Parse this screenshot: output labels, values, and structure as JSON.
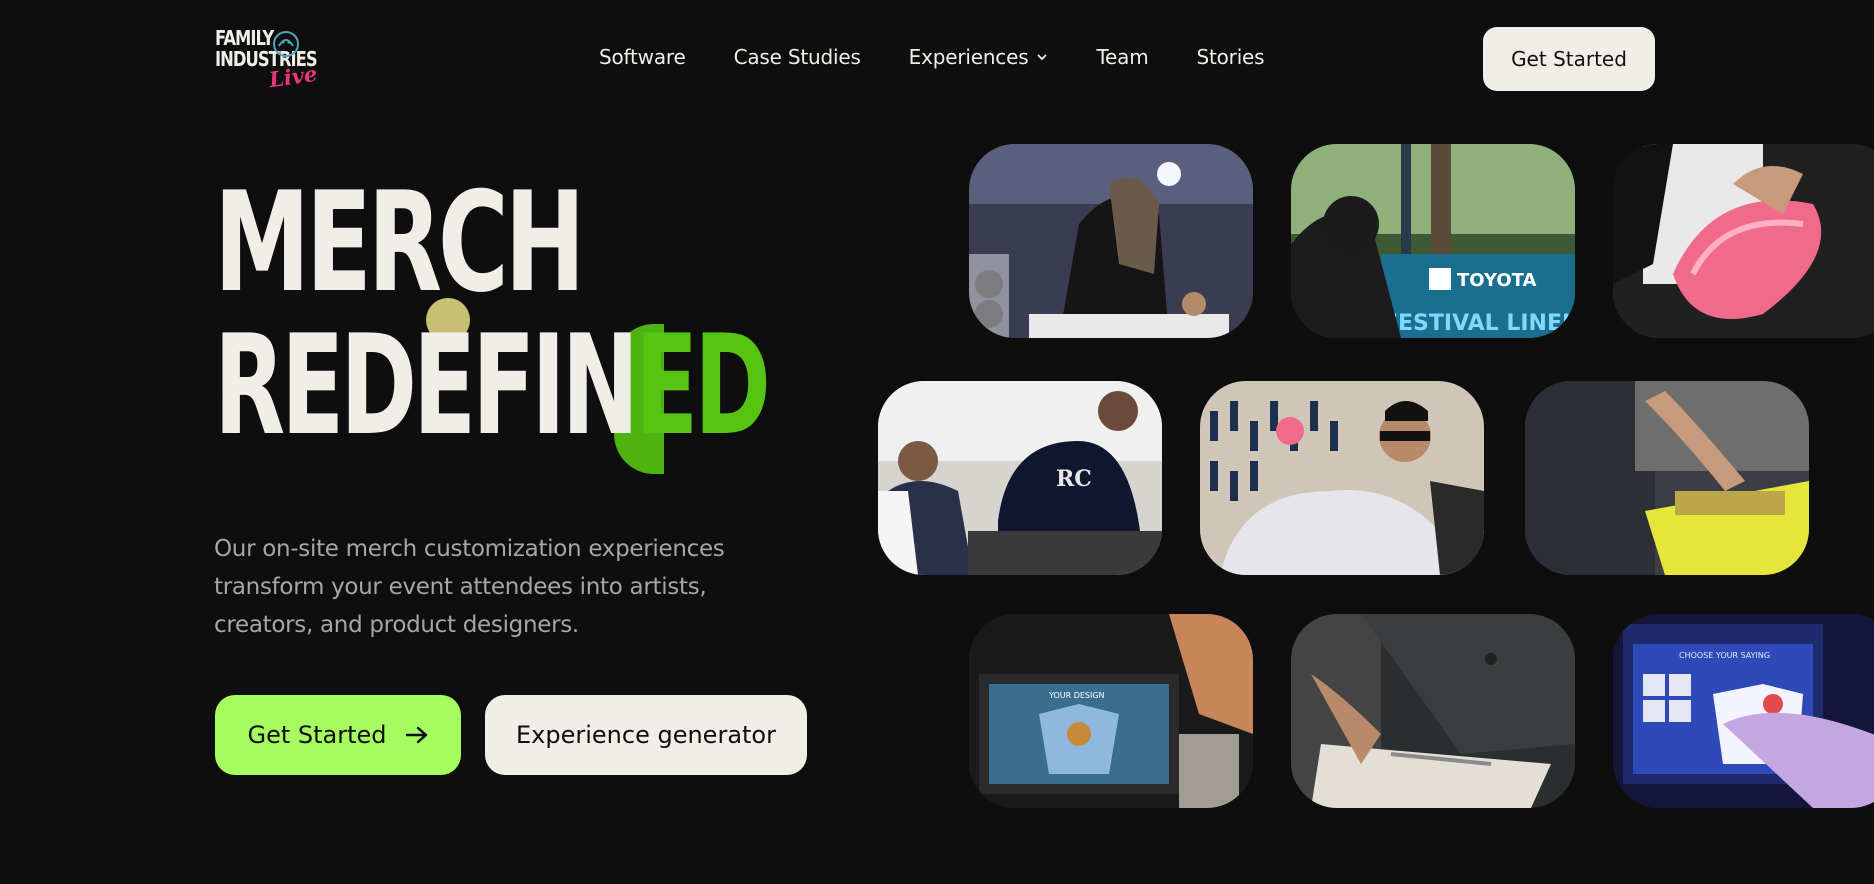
{
  "brand": {
    "logo_line1": "FAMILY",
    "logo_line2": "INDUSTRIES",
    "logo_script": "Live"
  },
  "nav": {
    "items": [
      {
        "label": "Software"
      },
      {
        "label": "Case Studies"
      },
      {
        "label": "Experiences"
      },
      {
        "label": "Team"
      },
      {
        "label": "Stories"
      }
    ],
    "cta_label": "Get Started"
  },
  "hero": {
    "title_line1": "MERCH",
    "title_line2_a": "REDEFI",
    "title_line2_b": "N",
    "title_line2_c": "ED",
    "description": "Our on-site merch customization experiences transform your event attendees into artists, creators, and product designers.",
    "primary_cta": "Get Started",
    "secondary_cta": "Experience generator"
  },
  "tiles": {
    "t1": {
      "subject": "artist-drawing"
    },
    "t2": {
      "sign_top": "TOYOTA",
      "sign_bottom": "FESTIVAL LINEUP"
    },
    "t3": {
      "subject": "pink-bag"
    },
    "t4": {
      "hat_text": "RC"
    },
    "t5": {
      "subject": "pegboard-shirt"
    },
    "t6": {
      "subject": "screen-print"
    },
    "t7": {
      "screen_text": "YOUR DESIGN"
    },
    "t8": {
      "subject": "heat-press"
    },
    "t9": {
      "screen_text": "CHOOSE YOUR SAYING"
    }
  },
  "colors": {
    "background": "#0e0e0e",
    "cream": "#f1eee8",
    "accent_green": "#a5fb5f",
    "title_green": "#55c512",
    "muted_text": "#a7a6a2",
    "logo_pink": "#e8367e"
  },
  "icons": {
    "nav_dropdown": "chevron-down-icon",
    "cta_arrow": "arrow-right-icon",
    "logo_mascot": "mascot-icon"
  }
}
